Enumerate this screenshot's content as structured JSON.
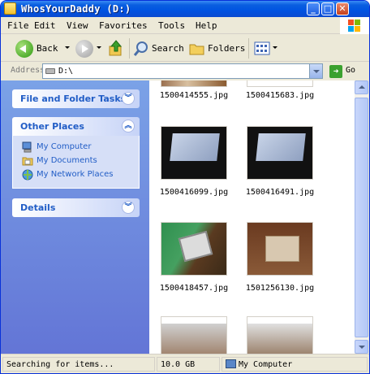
{
  "window": {
    "title": "WhosYourDaddy (D:)"
  },
  "menu": [
    "File",
    "Edit",
    "View",
    "Favorites",
    "Tools",
    "Help"
  ],
  "toolbar": {
    "back": "Back",
    "search": "Search",
    "folders": "Folders"
  },
  "address": {
    "label": "Address",
    "value": "D:\\",
    "go": "Go"
  },
  "tasks": {
    "file_folder_tasks": "File and Folder Tasks",
    "other_places": {
      "title": "Other Places",
      "items": [
        "My Computer",
        "My Documents",
        "My Network Places"
      ]
    },
    "details": "Details"
  },
  "files": [
    {
      "name": "1500414555.jpg"
    },
    {
      "name": "1500415683.jpg"
    },
    {
      "name": "1500416099.jpg"
    },
    {
      "name": "1500416491.jpg"
    },
    {
      "name": "1500418457.jpg"
    },
    {
      "name": "1501256130.jpg"
    }
  ],
  "status": {
    "message": "Searching for items...",
    "size": "10.0 GB",
    "location": "My Computer"
  },
  "colors": {
    "titlebar": "#0053e1",
    "taskpane": "#7ba2e7",
    "link": "#215dc6"
  }
}
